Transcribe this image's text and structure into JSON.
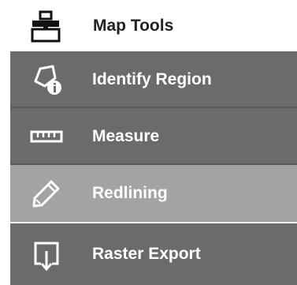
{
  "menu": {
    "header": {
      "label": "Map Tools",
      "icon": "toolbox-icon"
    },
    "items": [
      {
        "label": "Identify Region",
        "icon": "identify-region-icon",
        "state": "normal"
      },
      {
        "label": "Measure",
        "icon": "ruler-icon",
        "state": "normal"
      },
      {
        "label": "Redlining",
        "icon": "pencil-icon",
        "state": "selected"
      },
      {
        "label": "Raster Export",
        "icon": "raster-export-icon",
        "state": "normal"
      }
    ]
  },
  "colors": {
    "item_background": "#6b6b6b",
    "item_selected_background": "#a3a3a3",
    "item_text": "#ffffff",
    "header_text": "#222222"
  }
}
